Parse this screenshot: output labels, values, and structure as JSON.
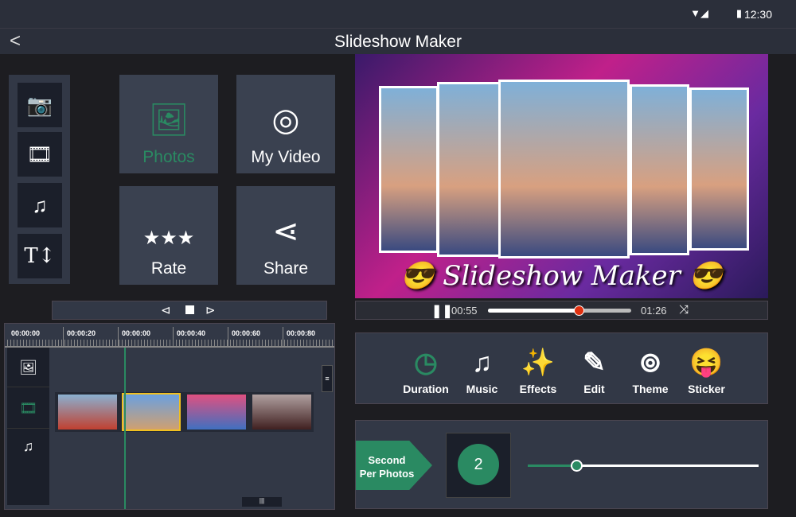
{
  "status": {
    "time": "12:30"
  },
  "header": {
    "title": "Slideshow Maker",
    "back_icon": "chevron-left-icon"
  },
  "sidebar": {
    "items": [
      {
        "icon": "camera-icon",
        "glyph": "📷"
      },
      {
        "icon": "film-icon",
        "glyph": "🎞"
      },
      {
        "icon": "music-note-icon",
        "glyph": "♫"
      },
      {
        "icon": "text-size-icon",
        "glyph": "T↕"
      }
    ]
  },
  "tiles": [
    {
      "label": "Photos",
      "glyph": "🖼",
      "icon": "gallery-icon",
      "active": true
    },
    {
      "label": "My Video",
      "glyph": "◎",
      "icon": "film-reel-icon"
    },
    {
      "label": "Rate",
      "glyph": "★★★",
      "icon": "rate-stars-icon"
    },
    {
      "label": "Share",
      "glyph": "⋖",
      "icon": "share-icon"
    }
  ],
  "preview": {
    "title": "Slideshow Maker"
  },
  "player": {
    "current": "00:55",
    "total": "01:26",
    "progress": 0.64
  },
  "timeline": {
    "ticks": [
      "00:00:00",
      "00:00:20",
      "00:00:00",
      "00:00:40",
      "00:00:60",
      "00:00:80"
    ]
  },
  "tools": [
    {
      "label": "Duration",
      "glyph": "◷",
      "icon": "timer-icon"
    },
    {
      "label": "Music",
      "glyph": "♫",
      "icon": "music-icon"
    },
    {
      "label": "Effects",
      "glyph": "✨",
      "icon": "magic-wand-icon"
    },
    {
      "label": "Edit",
      "glyph": "✎",
      "icon": "edit-icon"
    },
    {
      "label": "Theme",
      "glyph": "⊚",
      "icon": "theme-icon"
    },
    {
      "label": "Sticker",
      "glyph": "😝",
      "icon": "sticker-icon"
    }
  ],
  "duration": {
    "label": "Second Per Photos",
    "value": "2",
    "slider": 0.21
  },
  "colors": {
    "accent": "#2a8a62",
    "panel": "#323846"
  }
}
